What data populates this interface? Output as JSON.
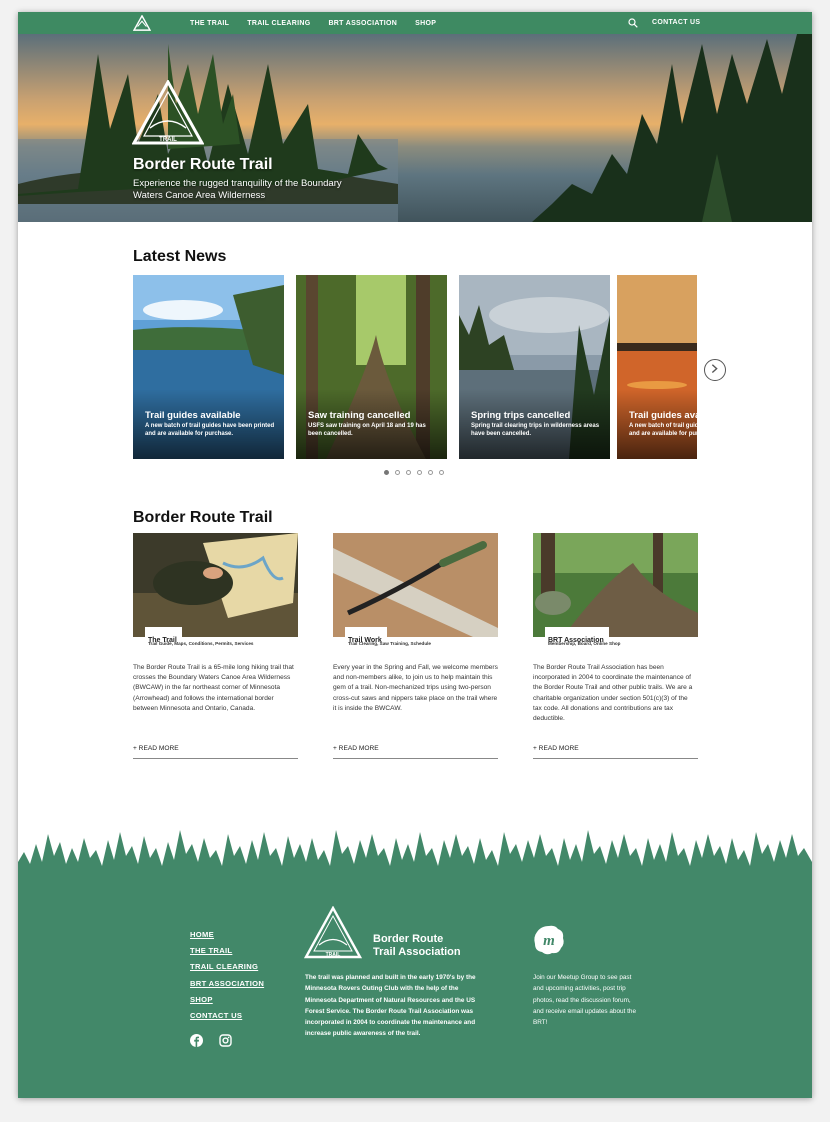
{
  "nav": {
    "links": [
      "THE TRAIL",
      "TRAIL CLEARING",
      "BRT ASSOCIATION",
      "SHOP"
    ],
    "contact": "CONTACT US"
  },
  "hero": {
    "title": "Border Route Trail",
    "subtitle": "Experience the rugged tranquility of the Boundary Waters Canoe Area Wilderness",
    "badge_text": [
      "BORDER",
      "ROUTE",
      "TRAIL"
    ]
  },
  "news": {
    "heading": "Latest News",
    "items": [
      {
        "title": "Trail guides available",
        "desc": "A new batch of trail guides have been printed and are available for purchase."
      },
      {
        "title": "Saw training cancelled",
        "desc": "USFS saw training on April 18 and 19 has been cancelled."
      },
      {
        "title": "Spring trips cancelled",
        "desc": "Spring trail clearing trips in wilderness areas have been cancelled."
      },
      {
        "title": "Trail guides available",
        "desc": "A new batch of trail guides have been printed and are available for purchase."
      }
    ]
  },
  "brt": {
    "heading": "Border Route Trail",
    "cards": [
      {
        "label": "The Trail",
        "sub": "Trail Guide, Maps, Conditions, Permits, Services",
        "body": "The Border Route Trail is a 65-mile long hiking trail that crosses the Boundary Waters Canoe Area Wilderness (BWCAW) in the far northeast corner of Minnesota (Arrowhead) and follows the international border between Minnesota and Ontario, Canada.",
        "more": "+ READ MORE"
      },
      {
        "label": "Trail Work",
        "sub": "Trail Clearing, Saw Training, Schedule",
        "body": "Every year in the Spring and Fall, we welcome members and non-members alike, to join us to help maintain this gem of a trail. Non-mechanized trips using two-person cross-cut saws and nippers take place on the trail where it is inside the BWCAW.",
        "more": "+ READ MORE"
      },
      {
        "label": "BRT Association",
        "sub": "Membership, Board, Online Shop",
        "body": "The Border Route Trail Association has been incorporated in 2004 to coordinate the maintenance of the Border Route Trail and other public trails. We are a charitable organization under section 501(c)(3) of the tax code. All donations and contributions are tax deductible.",
        "more": "+ READ MORE"
      }
    ]
  },
  "footer": {
    "links": [
      "HOME",
      "THE TRAIL",
      "TRAIL CLEARING",
      "BRT ASSOCIATION",
      "SHOP",
      "CONTACT US"
    ],
    "org_line1": "Border Route",
    "org_line2": "Trail Association",
    "about": "The trail was planned and built in the early 1970's by the Minnesota Rovers Outing Club with the help of the Minnesota Department of Natural Resources and the US Forest Service. The Border Route Trail Association was incorporated in 2004 to coordinate the maintenance and increase public awareness of the trail.",
    "meetup": "Join our Meetup Group to see past and upcoming activities, post trip photos, read the discussion forum, and receive email updates about the BRT!"
  },
  "colors": {
    "green": "#3e8a62",
    "footer_green": "#428869"
  },
  "icons": [
    "brt-logo-icon",
    "search-icon",
    "chevron-right-icon",
    "facebook-icon",
    "instagram-icon",
    "meetup-icon"
  ]
}
